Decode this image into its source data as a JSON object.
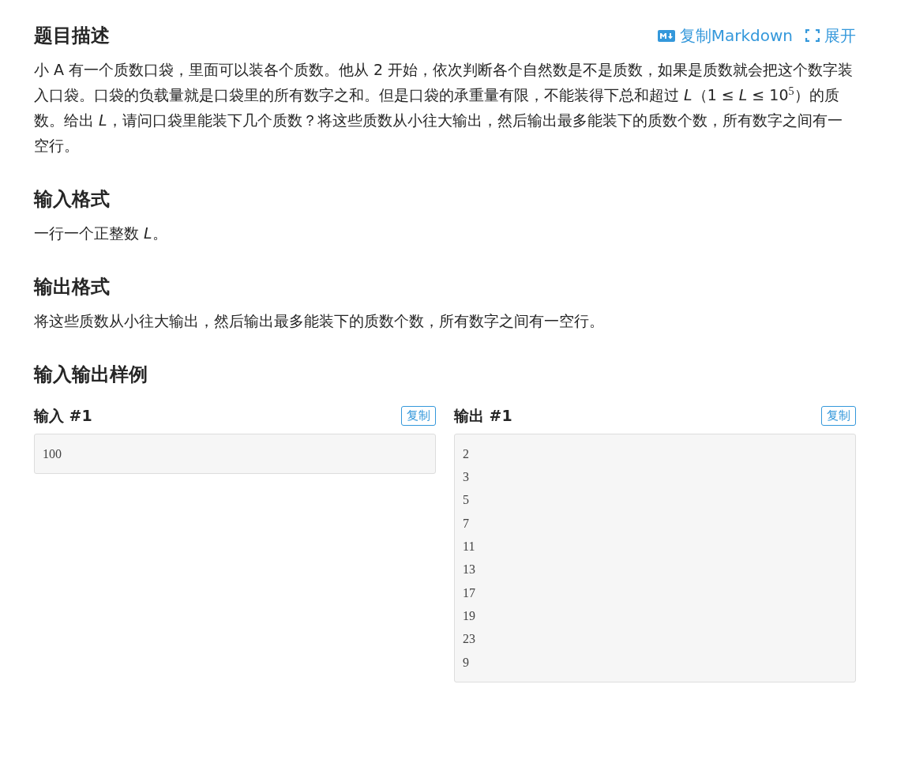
{
  "description": {
    "title": "题目描述",
    "actions": [
      {
        "kind": "markdown",
        "label": "复制Markdown"
      },
      {
        "kind": "expand",
        "label": "展开"
      }
    ],
    "text": "小 A 有一个质数口袋，里面可以装各个质数。他从 2 开始，依次判断各个自然数是不是质数，如果是质数就会把这个数字装入口袋。口袋的负载量就是口袋里的所有数字之和。但是口袋的承重量有限，不能装得下总和超过 *L*（1 ≤ *L* ≤ 10$^{5}$）的质数。给出 *L*，请问口袋里能装下几个质数？将这些质数从小往大输出，然后输出最多能装下的质数个数，所有数字之间有一空行。"
  },
  "input_format": {
    "title": "输入格式",
    "text": "一行一个正整数 *L*。"
  },
  "output_format": {
    "title": "输出格式",
    "text": "将这些质数从小往大输出，然后输出最多能装下的质数个数，所有数字之间有一空行。"
  },
  "samples": {
    "title": "输入输出样例",
    "items": [
      {
        "label": "输入 #1",
        "copy": "复制",
        "lines": [
          "100"
        ]
      },
      {
        "label": "输出 #1",
        "copy": "复制",
        "lines": [
          "2",
          "3",
          "5",
          "7",
          "11",
          "13",
          "17",
          "19",
          "23",
          "9"
        ]
      }
    ]
  }
}
